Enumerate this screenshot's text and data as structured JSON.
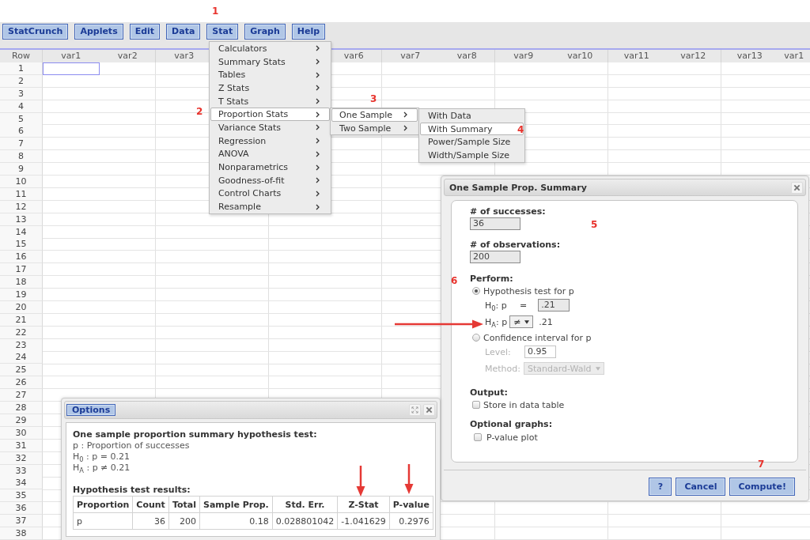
{
  "annotations": [
    "1",
    "2",
    "3",
    "4",
    "5",
    "6",
    "7"
  ],
  "menu_bar": [
    "StatCrunch",
    "Applets",
    "Edit",
    "Data",
    "Stat",
    "Graph",
    "Help"
  ],
  "stat_menu": [
    {
      "label": "Calculators",
      "selected": false
    },
    {
      "label": "Summary Stats",
      "selected": false
    },
    {
      "label": "Tables",
      "selected": false
    },
    {
      "label": "Z Stats",
      "selected": false
    },
    {
      "label": "T Stats",
      "selected": false
    },
    {
      "label": "Proportion Stats",
      "selected": true
    },
    {
      "label": "Variance Stats",
      "selected": false
    },
    {
      "label": "Regression",
      "selected": false
    },
    {
      "label": "ANOVA",
      "selected": false
    },
    {
      "label": "Nonparametrics",
      "selected": false
    },
    {
      "label": "Goodness-of-fit",
      "selected": false
    },
    {
      "label": "Control Charts",
      "selected": false
    },
    {
      "label": "Resample",
      "selected": false
    }
  ],
  "proportion_submenu": [
    {
      "label": "One Sample",
      "selected": true
    },
    {
      "label": "Two Sample",
      "selected": false
    }
  ],
  "one_sample_submenu": [
    {
      "label": "With Data",
      "selected": false
    },
    {
      "label": "With Summary",
      "selected": true
    },
    {
      "label": "Power/Sample Size",
      "selected": false
    },
    {
      "label": "Width/Sample Size",
      "selected": false
    }
  ],
  "sheet": {
    "row_header": "Row",
    "columns": [
      "var1",
      "var2",
      "var3",
      null,
      null,
      "var6",
      "var7",
      "var8",
      "var9",
      "var10",
      "var11",
      "var12",
      "var13",
      "var1"
    ],
    "rows": [
      {
        "label": "1",
        "selected": true
      },
      {
        "label": "2",
        "selected": false
      },
      {
        "label": "3",
        "selected": false
      },
      {
        "label": "4",
        "selected": false
      },
      {
        "label": "5",
        "selected": false
      },
      {
        "label": "6",
        "selected": false
      },
      {
        "label": "7",
        "selected": false
      },
      {
        "label": "8",
        "selected": false
      },
      {
        "label": "9",
        "selected": false
      },
      {
        "label": "10",
        "selected": false
      },
      {
        "label": "11",
        "selected": false
      },
      {
        "label": "12",
        "selected": false
      },
      {
        "label": "13",
        "selected": false
      },
      {
        "label": "14",
        "selected": false
      },
      {
        "label": "15",
        "selected": false
      },
      {
        "label": "16",
        "selected": false
      },
      {
        "label": "17",
        "selected": false
      },
      {
        "label": "18",
        "selected": false
      },
      {
        "label": "19",
        "selected": false
      },
      {
        "label": "20",
        "selected": false
      },
      {
        "label": "21",
        "selected": false
      },
      {
        "label": "22",
        "selected": false
      },
      {
        "label": "23",
        "selected": false
      },
      {
        "label": "24",
        "selected": false
      },
      {
        "label": "25",
        "selected": false
      },
      {
        "label": "26",
        "selected": false
      },
      {
        "label": "27",
        "selected": false
      },
      {
        "label": "28",
        "selected": false
      },
      {
        "label": "29",
        "selected": false
      },
      {
        "label": "30",
        "selected": false
      },
      {
        "label": "31",
        "selected": false
      },
      {
        "label": "32",
        "selected": false
      },
      {
        "label": "33",
        "selected": false
      },
      {
        "label": "34",
        "selected": false
      },
      {
        "label": "35",
        "selected": false
      },
      {
        "label": "36",
        "selected": false
      },
      {
        "label": "37",
        "selected": false
      },
      {
        "label": "38",
        "selected": false
      }
    ]
  },
  "prop_dialog": {
    "title": "One Sample Prop. Summary",
    "successes": {
      "label": "# of successes:",
      "value": "36"
    },
    "observations": {
      "label": "# of observations:",
      "value": "200"
    },
    "perform": {
      "heading": "Perform:",
      "hypothesis_test": {
        "label": "Hypothesis test for p",
        "selected": true,
        "null_hypothesis": {
          "label": "H$_{0}$: p",
          "operator": "=",
          "value": ".21"
        },
        "alternative": {
          "label": "H$_{A}$: p",
          "operator": "≠",
          "value": ".21"
        }
      },
      "confidence_interval": {
        "label": "Confidence interval for p",
        "selected": false,
        "disabled": true,
        "level": {
          "label": "Level:",
          "value": "0.95"
        },
        "method": {
          "label": "Method:",
          "value": "Standard-Wald"
        }
      }
    },
    "output": {
      "heading": "Output:",
      "options": [
        {
          "label": "Store in data table",
          "checked": false
        }
      ]
    },
    "optional_graphs": {
      "heading": "Optional graphs:",
      "options": [
        {
          "label": "P-value plot",
          "checked": false
        }
      ]
    },
    "buttons": [
      "?",
      "Cancel",
      "Compute!"
    ]
  },
  "results_window": {
    "title_button": "Options",
    "heading": "One sample proportion summary hypothesis test:",
    "lines": [
      "p : Proportion of successes",
      "H$_{0}$ : p = 0.21",
      "H$_{A}$ : p ≠ 0.21"
    ],
    "table_title": "Hypothesis test results:",
    "table": {
      "columns": [
        "Proportion",
        "Count",
        "Total",
        "Sample Prop.",
        "Std. Err.",
        "Z-Stat",
        "P-value"
      ],
      "rows": [
        [
          "p",
          "36",
          "200",
          "0.18",
          "0.028801042",
          "-1.041629",
          "0.2976"
        ]
      ]
    }
  }
}
